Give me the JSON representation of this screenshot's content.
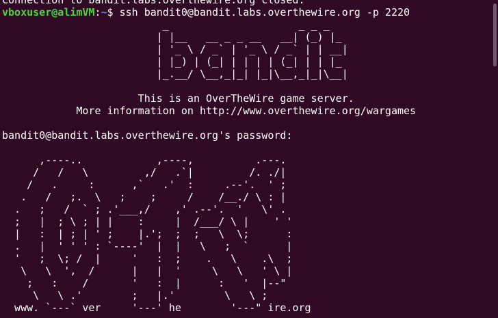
{
  "terminal": {
    "top_line": "Connection to bandit.labs.overthewire.org closed.",
    "prompt": {
      "user_host": "vboxuser@alimVM",
      "separator": ":",
      "path": "~",
      "symbol": "$ ",
      "command": "ssh bandit0@bandit.labs.overthewire.org -p 2220"
    },
    "banner_lines": [
      "                          _                     _ _ _",
      "                         | |__   __ _ _ __   __| (_) |_",
      "                         | '_ \\ / _` | '_ \\ / _` | | __|",
      "                         | |_) | (_| | | | | (_| | | |_",
      "                         |_.__/ \\__,_|_| |_|\\__,_|_|\\__|"
    ],
    "message_lines": [
      "",
      "                      This is an OverTheWire game server.",
      "            More information on http://www.overthewire.org/wargames",
      ""
    ],
    "password_prompt": "bandit0@bandit.labs.overthewire.org's password:",
    "art_lines": [
      "",
      "      ,----..            ,----,          .---.",
      "     /   /   \\         ,/   .`|         /. ./|",
      "    /   .     :      ,`   .'  :     .--'.  ' ;",
      "   .   /   ;.  \\   ;    ;     /    /__./ \\ : |",
      "  .   ;   /  ` ; .'___,/    ,' .--'.  '   \\' .",
      "  ;   |  ; \\ ; | |    :     |  /___/ \\ |    ' '",
      "  |   :  | ; | ' ;    |.';  ;  ;   \\  \\;      :",
      "  .   |  ' ' ' : `----'  |  |   \\   ;  `      |",
      "  '   ;  \\; /  |     '   :  ;    .   \\    .\\  ;",
      "   \\   \\  ',  /      |   |  '     \\   \\   ' \\ |",
      "    ;   :    /       '   :  |      :   '  |--\"",
      "     \\   \\ .'        ;   |.'        \\   \\ ;",
      "  www. `---` ver     '---' he        '---\" ire.org"
    ]
  }
}
